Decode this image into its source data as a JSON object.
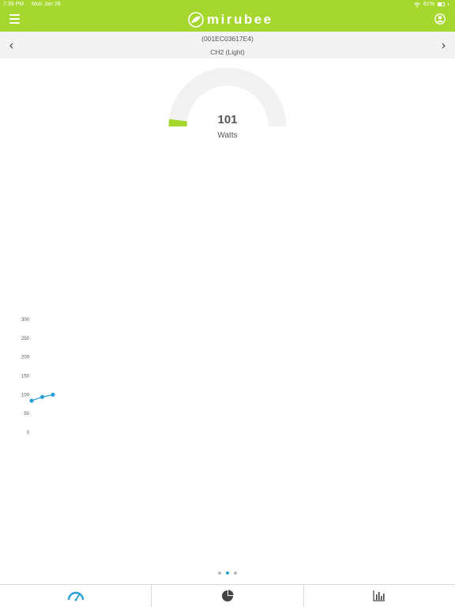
{
  "status_bar": {
    "time": "7:39 PM",
    "date": "Mon Jan 28",
    "battery": "61%"
  },
  "header": {
    "logo_text": "mirubee",
    "menu_icon": "hamburger-menu-icon",
    "user_icon": "user-account-icon"
  },
  "device": {
    "id_label": "(001EC03617E4)",
    "channel_label": "CH2 (Light)"
  },
  "gauge": {
    "value": "101",
    "unit": "Watts",
    "fraction": 0.04,
    "track_color": "#f2f2f2",
    "fill_color": "#a5d72f"
  },
  "chart_data": {
    "type": "line",
    "y_ticks": [
      "300",
      "250",
      "200",
      "150",
      "100",
      "50",
      "0"
    ],
    "ylim": [
      0,
      300
    ],
    "x": [
      0,
      1,
      2
    ],
    "values": [
      84,
      94,
      100
    ],
    "color": "#2a9fd6"
  },
  "pager": {
    "pages": 3,
    "active_index": 1
  },
  "tabs": [
    {
      "name": "tab-live",
      "icon": "speedometer-icon",
      "active": true
    },
    {
      "name": "tab-consumption",
      "icon": "pie-chart-icon",
      "active": false
    },
    {
      "name": "tab-history",
      "icon": "bar-chart-icon",
      "active": false
    }
  ],
  "colors": {
    "brand": "#a5d72f",
    "accent": "#2a9fd6"
  }
}
